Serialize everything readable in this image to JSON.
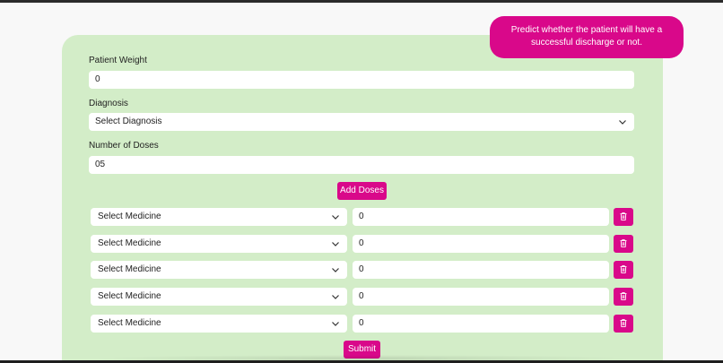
{
  "tooltip": {
    "text": "Predict whether the patient will have a successful discharge or not."
  },
  "form": {
    "weight_label": "Patient Weight",
    "weight_value": "0",
    "diagnosis_label": "Diagnosis",
    "diagnosis_value": "Select Diagnosis",
    "doses_label": "Number of Doses",
    "doses_value": "05",
    "add_doses_label": "Add Doses",
    "submit_label": "Submit"
  },
  "doses": [
    {
      "medicine": "Select Medicine",
      "amount": "0"
    },
    {
      "medicine": "Select Medicine",
      "amount": "0"
    },
    {
      "medicine": "Select Medicine",
      "amount": "0"
    },
    {
      "medicine": "Select Medicine",
      "amount": "0"
    },
    {
      "medicine": "Select Medicine",
      "amount": "0"
    }
  ],
  "icons": {
    "dropdown": "chevron-down-icon",
    "delete": "trash-icon"
  },
  "colors": {
    "accent": "#d9088a",
    "card_background": "#d3edc8",
    "page_background": "#f8f8f8"
  }
}
